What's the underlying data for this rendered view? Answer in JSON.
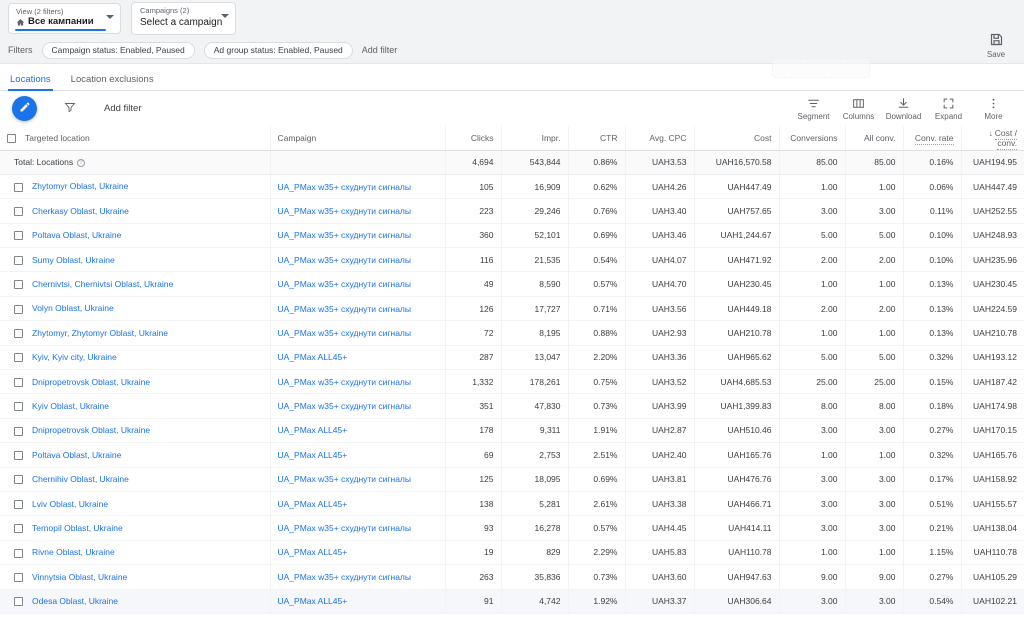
{
  "topbar": {
    "view_select": {
      "label": "View (2 filters)",
      "value": "Все кампании",
      "icon": "home-icon"
    },
    "campaign_select": {
      "label": "Campaigns (2)",
      "value": "Select a campaign"
    }
  },
  "filterbar": {
    "filters_label": "Filters",
    "chips": [
      "Campaign status: Enabled, Paused",
      "Ad group status: Enabled, Paused"
    ],
    "add_filter": "Add filter"
  },
  "save": {
    "label": "Save",
    "icon": "save-disk-icon"
  },
  "tabs": [
    {
      "label": "Locations",
      "active": true
    },
    {
      "label": "Location exclusions",
      "active": false
    }
  ],
  "toolbar": {
    "edit_fab_icon": "pencil-icon",
    "filter_icon": "funnel-icon",
    "add_filter": "Add filter",
    "actions": [
      {
        "label": "Segment",
        "icon": "segment-icon"
      },
      {
        "label": "Columns",
        "icon": "columns-icon"
      },
      {
        "label": "Download",
        "icon": "download-icon"
      },
      {
        "label": "Expand",
        "icon": "expand-icon"
      },
      {
        "label": "More",
        "icon": "more-vert-icon"
      }
    ]
  },
  "table": {
    "columns": [
      {
        "key": "location",
        "label": "Targeted location",
        "align": "left"
      },
      {
        "key": "campaign",
        "label": "Campaign",
        "align": "left"
      },
      {
        "key": "clicks",
        "label": "Clicks",
        "align": "right"
      },
      {
        "key": "impr",
        "label": "Impr.",
        "align": "right"
      },
      {
        "key": "ctr",
        "label": "CTR",
        "align": "right"
      },
      {
        "key": "avg_cpc",
        "label": "Avg. CPC",
        "align": "right"
      },
      {
        "key": "cost",
        "label": "Cost",
        "align": "right"
      },
      {
        "key": "conversions",
        "label": "Conversions",
        "align": "right"
      },
      {
        "key": "all_conv",
        "label": "All conv.",
        "align": "right"
      },
      {
        "key": "conv_rate",
        "label": "Conv. rate",
        "align": "right",
        "dotted": true
      },
      {
        "key": "cost_conv",
        "label": "Cost / conv.",
        "align": "right",
        "dotted": true,
        "sorted": "desc"
      }
    ],
    "total_row": {
      "label": "Total: Locations",
      "clicks": "4,694",
      "impr": "543,844",
      "ctr": "0.86%",
      "avg_cpc": "UAH3.53",
      "cost": "UAH16,570.58",
      "conversions": "85.00",
      "all_conv": "85.00",
      "conv_rate": "0.16%",
      "cost_conv": "UAH194.95"
    },
    "rows": [
      {
        "location": "Zhytomyr Oblast, Ukraine",
        "campaign": "UA_PMax w35+ схуднути сигналы",
        "clicks": "105",
        "impr": "16,909",
        "ctr": "0.62%",
        "avg_cpc": "UAH4.26",
        "cost": "UAH447.49",
        "conversions": "1.00",
        "all_conv": "1.00",
        "conv_rate": "0.06%",
        "cost_conv": "UAH447.49"
      },
      {
        "location": "Cherkasy Oblast, Ukraine",
        "campaign": "UA_PMax w35+ схуднути сигналы",
        "clicks": "223",
        "impr": "29,246",
        "ctr": "0.76%",
        "avg_cpc": "UAH3.40",
        "cost": "UAH757.65",
        "conversions": "3.00",
        "all_conv": "3.00",
        "conv_rate": "0.11%",
        "cost_conv": "UAH252.55"
      },
      {
        "location": "Poltava Oblast, Ukraine",
        "campaign": "UA_PMax w35+ схуднути сигналы",
        "clicks": "360",
        "impr": "52,101",
        "ctr": "0.69%",
        "avg_cpc": "UAH3.46",
        "cost": "UAH1,244.67",
        "conversions": "5.00",
        "all_conv": "5.00",
        "conv_rate": "0.10%",
        "cost_conv": "UAH248.93"
      },
      {
        "location": "Sumy Oblast, Ukraine",
        "campaign": "UA_PMax w35+ схуднути сигналы",
        "clicks": "116",
        "impr": "21,535",
        "ctr": "0.54%",
        "avg_cpc": "UAH4.07",
        "cost": "UAH471.92",
        "conversions": "2.00",
        "all_conv": "2.00",
        "conv_rate": "0.10%",
        "cost_conv": "UAH235.96"
      },
      {
        "location": "Chernivtsi, Chernivtsi Oblast, Ukraine",
        "campaign": "UA_PMax w35+ схуднути сигналы",
        "clicks": "49",
        "impr": "8,590",
        "ctr": "0.57%",
        "avg_cpc": "UAH4.70",
        "cost": "UAH230.45",
        "conversions": "1.00",
        "all_conv": "1.00",
        "conv_rate": "0.13%",
        "cost_conv": "UAH230.45"
      },
      {
        "location": "Volyn Oblast, Ukraine",
        "campaign": "UA_PMax w35+ схуднути сигналы",
        "clicks": "126",
        "impr": "17,727",
        "ctr": "0.71%",
        "avg_cpc": "UAH3.56",
        "cost": "UAH449.18",
        "conversions": "2.00",
        "all_conv": "2.00",
        "conv_rate": "0.13%",
        "cost_conv": "UAH224.59"
      },
      {
        "location": "Zhytomyr, Zhytomyr Oblast, Ukraine",
        "campaign": "UA_PMax w35+ схуднути сигналы",
        "clicks": "72",
        "impr": "8,195",
        "ctr": "0.88%",
        "avg_cpc": "UAH2.93",
        "cost": "UAH210.78",
        "conversions": "1.00",
        "all_conv": "1.00",
        "conv_rate": "0.13%",
        "cost_conv": "UAH210.78"
      },
      {
        "location": "Kyiv, Kyiv city, Ukraine",
        "campaign": "UA_PMax ALL45+",
        "clicks": "287",
        "impr": "13,047",
        "ctr": "2.20%",
        "avg_cpc": "UAH3.36",
        "cost": "UAH965.62",
        "conversions": "5.00",
        "all_conv": "5.00",
        "conv_rate": "0.32%",
        "cost_conv": "UAH193.12"
      },
      {
        "location": "Dnipropetrovsk Oblast, Ukraine",
        "campaign": "UA_PMax w35+ схуднути сигналы",
        "clicks": "1,332",
        "impr": "178,261",
        "ctr": "0.75%",
        "avg_cpc": "UAH3.52",
        "cost": "UAH4,685.53",
        "conversions": "25.00",
        "all_conv": "25.00",
        "conv_rate": "0.15%",
        "cost_conv": "UAH187.42"
      },
      {
        "location": "Kyiv Oblast, Ukraine",
        "campaign": "UA_PMax w35+ схуднути сигналы",
        "clicks": "351",
        "impr": "47,830",
        "ctr": "0.73%",
        "avg_cpc": "UAH3.99",
        "cost": "UAH1,399.83",
        "conversions": "8.00",
        "all_conv": "8.00",
        "conv_rate": "0.18%",
        "cost_conv": "UAH174.98"
      },
      {
        "location": "Dnipropetrovsk Oblast, Ukraine",
        "campaign": "UA_PMax ALL45+",
        "clicks": "178",
        "impr": "9,311",
        "ctr": "1.91%",
        "avg_cpc": "UAH2.87",
        "cost": "UAH510.46",
        "conversions": "3.00",
        "all_conv": "3.00",
        "conv_rate": "0.27%",
        "cost_conv": "UAH170.15"
      },
      {
        "location": "Poltava Oblast, Ukraine",
        "campaign": "UA_PMax ALL45+",
        "clicks": "69",
        "impr": "2,753",
        "ctr": "2.51%",
        "avg_cpc": "UAH2.40",
        "cost": "UAH165.76",
        "conversions": "1.00",
        "all_conv": "1.00",
        "conv_rate": "0.32%",
        "cost_conv": "UAH165.76"
      },
      {
        "location": "Chernihiv Oblast, Ukraine",
        "campaign": "UA_PMax w35+ схуднути сигналы",
        "clicks": "125",
        "impr": "18,095",
        "ctr": "0.69%",
        "avg_cpc": "UAH3.81",
        "cost": "UAH476.76",
        "conversions": "3.00",
        "all_conv": "3.00",
        "conv_rate": "0.17%",
        "cost_conv": "UAH158.92"
      },
      {
        "location": "Lviv Oblast, Ukraine",
        "campaign": "UA_PMax ALL45+",
        "clicks": "138",
        "impr": "5,281",
        "ctr": "2.61%",
        "avg_cpc": "UAH3.38",
        "cost": "UAH466.71",
        "conversions": "3.00",
        "all_conv": "3.00",
        "conv_rate": "0.51%",
        "cost_conv": "UAH155.57"
      },
      {
        "location": "Ternopil Oblast, Ukraine",
        "campaign": "UA_PMax w35+ схуднути сигналы",
        "clicks": "93",
        "impr": "16,278",
        "ctr": "0.57%",
        "avg_cpc": "UAH4.45",
        "cost": "UAH414.11",
        "conversions": "3.00",
        "all_conv": "3.00",
        "conv_rate": "0.21%",
        "cost_conv": "UAH138.04"
      },
      {
        "location": "Rivne Oblast, Ukraine",
        "campaign": "UA_PMax ALL45+",
        "clicks": "19",
        "impr": "829",
        "ctr": "2.29%",
        "avg_cpc": "UAH5.83",
        "cost": "UAH110.78",
        "conversions": "1.00",
        "all_conv": "1.00",
        "conv_rate": "1.15%",
        "cost_conv": "UAH110.78"
      },
      {
        "location": "Vinnytsia Oblast, Ukraine",
        "campaign": "UA_PMax w35+ схуднути сигналы",
        "clicks": "263",
        "impr": "35,836",
        "ctr": "0.73%",
        "avg_cpc": "UAH3.60",
        "cost": "UAH947.63",
        "conversions": "9.00",
        "all_conv": "9.00",
        "conv_rate": "0.27%",
        "cost_conv": "UAH105.29"
      },
      {
        "location": "Odesa Oblast, Ukraine",
        "campaign": "UA_PMax ALL45+",
        "clicks": "91",
        "impr": "4,742",
        "ctr": "1.92%",
        "avg_cpc": "UAH3.37",
        "cost": "UAH306.64",
        "conversions": "3.00",
        "all_conv": "3.00",
        "conv_rate": "0.54%",
        "cost_conv": "UAH102.21",
        "hover": true
      }
    ]
  },
  "colors": {
    "accent": "#1a73e8",
    "link": "#1a73e8",
    "text": "#3c4043",
    "muted": "#5f6368",
    "bg_chrome": "#f1f3f4"
  }
}
